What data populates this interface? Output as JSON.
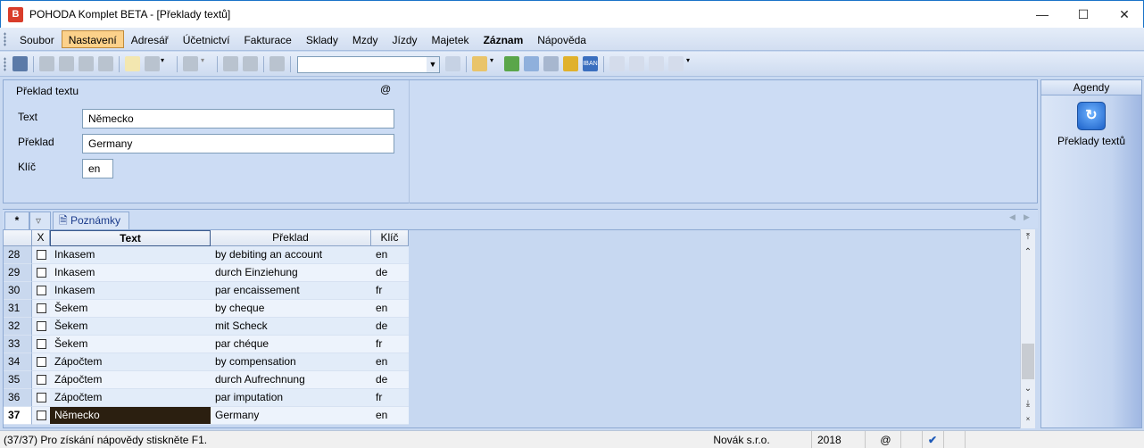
{
  "window": {
    "title": "POHODA Komplet BETA - [Překlady textů]",
    "icon_text": "B"
  },
  "menu": {
    "items": [
      "Soubor",
      "Nastavení",
      "Adresář",
      "Účetnictví",
      "Fakturace",
      "Sklady",
      "Mzdy",
      "Jízdy",
      "Majetek",
      "Záznam",
      "Nápověda"
    ],
    "active": "Nastavení",
    "bold": "Záznam"
  },
  "toolbar": {
    "combo_value": ""
  },
  "form": {
    "title": "Překlad textu",
    "at_symbol": "@",
    "text_label": "Text",
    "text_value": "Německo",
    "preklad_label": "Překlad",
    "preklad_value": "Germany",
    "klic_label": "Klíč",
    "klic_value": "en"
  },
  "agendy": {
    "header": "Agendy",
    "item_label": "Překlady textů",
    "item_icon": "translate-icon"
  },
  "tabs": {
    "star": "*",
    "notes_label": "Poznámky"
  },
  "grid": {
    "columns": {
      "x": "X",
      "text": "Text",
      "preklad": "Překlad",
      "klic": "Klíč"
    },
    "rows": [
      {
        "n": "28",
        "text": "Inkasem",
        "preklad": "by debiting an account",
        "klic": "en"
      },
      {
        "n": "29",
        "text": "Inkasem",
        "preklad": "durch Einziehung",
        "klic": "de"
      },
      {
        "n": "30",
        "text": "Inkasem",
        "preklad": "par encaissement",
        "klic": "fr"
      },
      {
        "n": "31",
        "text": "Šekem",
        "preklad": "by cheque",
        "klic": "en"
      },
      {
        "n": "32",
        "text": "Šekem",
        "preklad": "mit Scheck",
        "klic": "de"
      },
      {
        "n": "33",
        "text": "Šekem",
        "preklad": "par chéque",
        "klic": "fr"
      },
      {
        "n": "34",
        "text": "Zápočtem",
        "preklad": "by compensation",
        "klic": "en"
      },
      {
        "n": "35",
        "text": "Zápočtem",
        "preklad": "durch Aufrechnung",
        "klic": "de"
      },
      {
        "n": "36",
        "text": "Zápočtem",
        "preklad": "par imputation",
        "klic": "fr"
      },
      {
        "n": "37",
        "text": "Německo",
        "preklad": "Germany",
        "klic": "en"
      }
    ],
    "selected_row": "37"
  },
  "status": {
    "text": "(37/37) Pro získání nápovědy stiskněte F1.",
    "company": "Novák s.r.o.",
    "year": "2018",
    "at": "@"
  }
}
